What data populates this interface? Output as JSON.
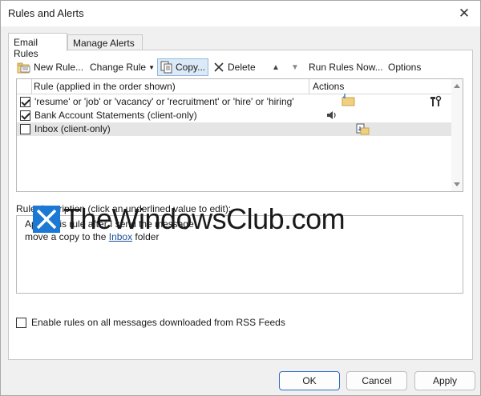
{
  "window": {
    "title": "Rules and Alerts"
  },
  "tabs": [
    {
      "label": "Email Rules"
    },
    {
      "label": "Manage Alerts"
    }
  ],
  "toolbar": {
    "new_rule": "New Rule...",
    "change_rule": "Change Rule",
    "copy": "Copy...",
    "delete": "Delete",
    "run_rules_now": "Run Rules Now...",
    "options": "Options"
  },
  "grid": {
    "col_rule": "Rule (applied in the order shown)",
    "col_actions": "Actions",
    "rows": [
      {
        "label": "'resume' or 'job' or 'vacancy' or 'recruitment' or 'hire' or 'hiring'",
        "checked": true
      },
      {
        "label": "Bank Account Statements  (client-only)",
        "checked": true
      },
      {
        "label": "Inbox  (client-only)",
        "checked": false
      }
    ]
  },
  "description": {
    "label": "Rule description (click an underlined value to edit):",
    "line1": "Apply this rule after I send the message",
    "line2_prefix": "move a copy to the ",
    "line2_link": "Inbox",
    "line2_suffix": " folder"
  },
  "watermark": {
    "text": "TheWindowsClub.com"
  },
  "rss": {
    "label": "Enable rules on all messages downloaded from RSS Feeds",
    "checked": false
  },
  "buttons": {
    "ok": "OK",
    "cancel": "Cancel",
    "apply": "Apply"
  },
  "colors": {
    "accent": "#2b6cc4",
    "selection": "#dceaf7",
    "logo": "#1b78d4"
  }
}
